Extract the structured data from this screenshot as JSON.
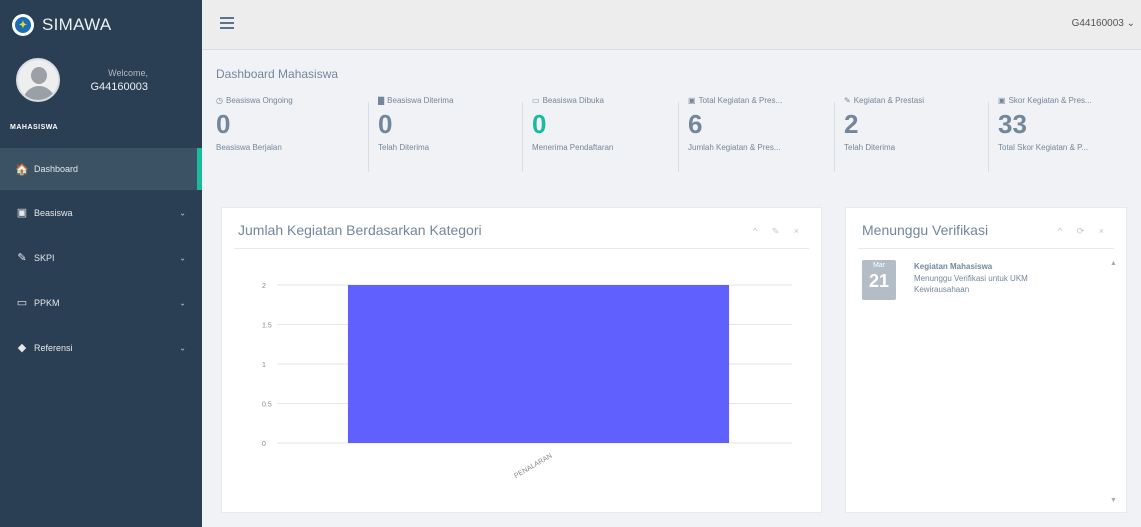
{
  "brand": {
    "name": "SIMAWA",
    "logo_icon": "university-logo-icon"
  },
  "profile": {
    "welcome": "Welcome,",
    "username": "G44160003",
    "role": "MAHASISWA"
  },
  "sidebar": {
    "items": [
      {
        "label": "Dashboard",
        "icon": "home-icon",
        "glyph": "🏠",
        "active": true,
        "has_chevron": false
      },
      {
        "label": "Beasiswa",
        "icon": "money-icon",
        "glyph": "▣",
        "active": false,
        "has_chevron": true
      },
      {
        "label": "SKPI",
        "icon": "edit-icon",
        "glyph": "✎",
        "active": false,
        "has_chevron": true
      },
      {
        "label": "PPKM",
        "icon": "monitor-icon",
        "glyph": "▭",
        "active": false,
        "has_chevron": true
      },
      {
        "label": "Referensi",
        "icon": "tag-icon",
        "glyph": "◆",
        "active": false,
        "has_chevron": true
      }
    ]
  },
  "topbar": {
    "user": "G44160003 ⌄"
  },
  "page": {
    "title": "Dashboard Mahasiswa"
  },
  "tiles": [
    {
      "icon_glyph": "◷",
      "label": "Beasiswa Ongoing",
      "count": "0",
      "sub": "Beasiswa Berjalan",
      "green": false
    },
    {
      "icon_glyph": "▇",
      "label": "Beasiswa Diterima",
      "count": "0",
      "sub": "Telah Diterima",
      "green": false
    },
    {
      "icon_glyph": "▭",
      "label": "Beasiswa Dibuka",
      "count": "0",
      "sub": "Menerima Pendaftaran",
      "green": true
    },
    {
      "icon_glyph": "▣",
      "label": "Total Kegiatan & Pres...",
      "count": "6",
      "sub": "Jumlah Kegiatan & Pres...",
      "green": false
    },
    {
      "icon_glyph": "✎",
      "label": "Kegiatan & Prestasi",
      "count": "2",
      "sub": "Telah Diterima",
      "green": false
    },
    {
      "icon_glyph": "▣",
      "label": "Skor Kegiatan & Pres...",
      "count": "33",
      "sub": "Total Skor Kegiatan & P...",
      "green": false
    }
  ],
  "chart_panel": {
    "title": "Jumlah Kegiatan Berdasarkan Kategori",
    "tools": "^ ✎ ×"
  },
  "chart_data": {
    "type": "bar",
    "categories": [
      "PENALARAN"
    ],
    "values": [
      2
    ],
    "ylim": [
      0,
      2
    ],
    "yticks": [
      "0",
      "0.5",
      "1",
      "1.5",
      "2"
    ],
    "bar_color": "#6060ff",
    "grid": true
  },
  "verif_panel": {
    "title": "Menunggu Verifikasi",
    "tools": "^ ⟳ ×",
    "event": {
      "month": "Mar",
      "day": "21",
      "title": "Kegiatan Mahasiswa",
      "desc": "Menunggu Verifikasi untuk UKM Kewirausahaan"
    }
  }
}
